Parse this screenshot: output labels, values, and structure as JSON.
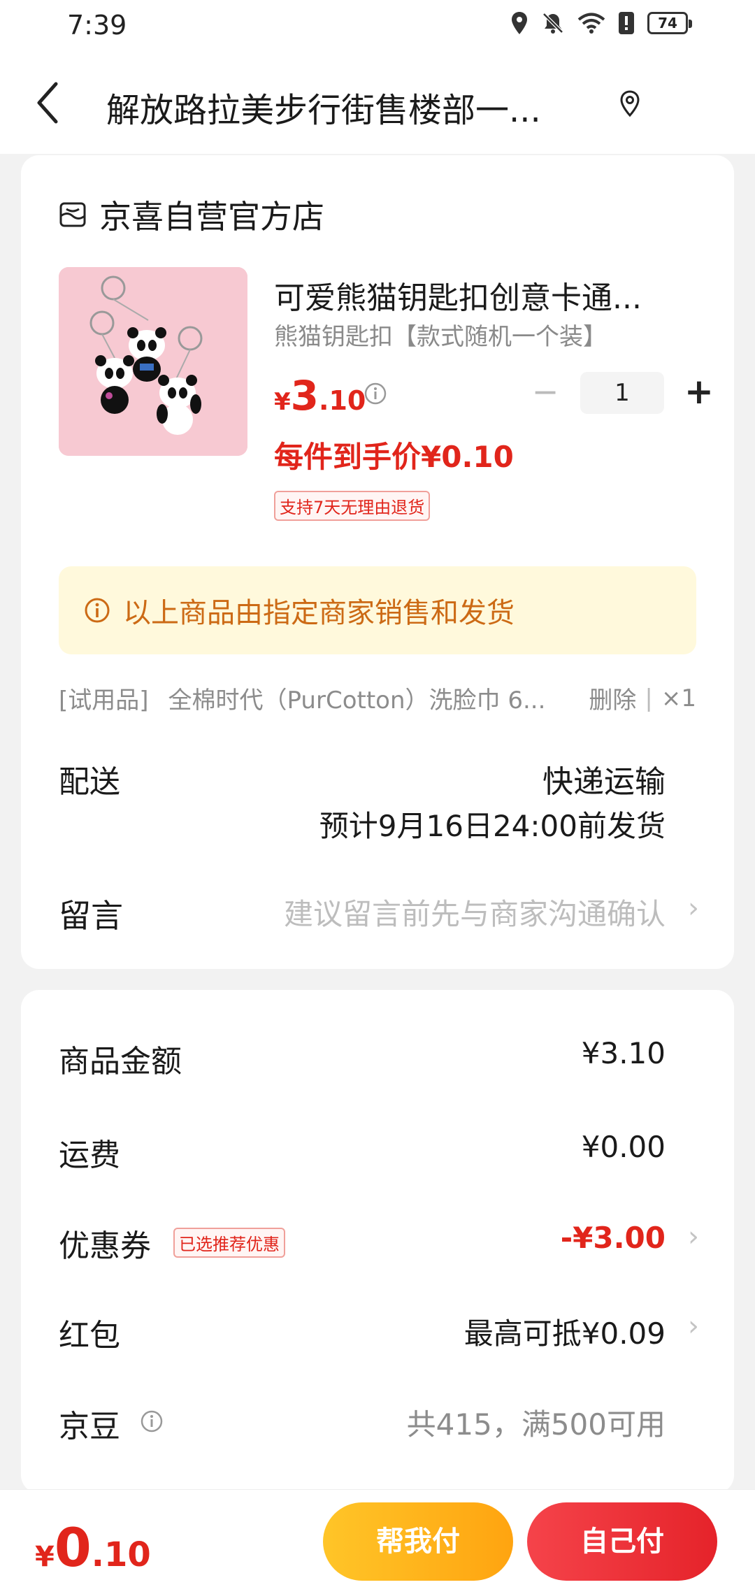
{
  "status_bar": {
    "time": "7:39",
    "battery": "74"
  },
  "header": {
    "title": "解放路拉美步行街售楼部一..."
  },
  "store": {
    "name": "京喜自营官方店"
  },
  "product": {
    "title": "可爱熊猫钥匙扣创意卡通...",
    "spec": "熊猫钥匙扣【款式随机一个装】",
    "price_currency": "¥",
    "price_int": "3",
    "price_dec": ".10",
    "unit_price": "每件到手价¥0.10",
    "return_badge": "支持7天无理由退货",
    "quantity": "1",
    "qty_minus": "−",
    "qty_plus": "+"
  },
  "notice": {
    "text": "以上商品由指定商家销售和发货"
  },
  "trial": {
    "tag": "[试用品]",
    "name": "全棉时代（PurCotton）洗脸巾 6...",
    "delete": "删除",
    "separator": "|",
    "count": "×1"
  },
  "shipping": {
    "label": "配送",
    "method": "快递运输",
    "time": "预计9月16日24:00前发货"
  },
  "message": {
    "label": "留言",
    "placeholder": "建议留言前先与商家沟通确认"
  },
  "summary": {
    "goods_label": "商品金额",
    "goods_value": "¥3.10",
    "freight_label": "运费",
    "freight_value": "¥0.00",
    "coupon_label": "优惠券",
    "coupon_badge": "已选推荐优惠",
    "coupon_value": "-¥3.00",
    "redpacket_label": "红包",
    "redpacket_value": "最高可抵¥0.09",
    "jingdou_label": "京豆",
    "jingdou_value": "共415，满500可用"
  },
  "bottom": {
    "total_currency": "¥",
    "total_int": "0",
    "total_dec": ".10",
    "help_pay": "帮我付",
    "self_pay": "自己付"
  },
  "icons": {
    "back": "chevron-left-icon",
    "location": "location-pin-icon",
    "store": "store-icon",
    "info": "info-icon",
    "chevron": "chevron-right-icon"
  },
  "colors": {
    "accent_red": "#e1251b",
    "notice_orange": "#cc6a15",
    "pay_yellow": "#ffb31a",
    "pay_red": "#ec2f36"
  }
}
